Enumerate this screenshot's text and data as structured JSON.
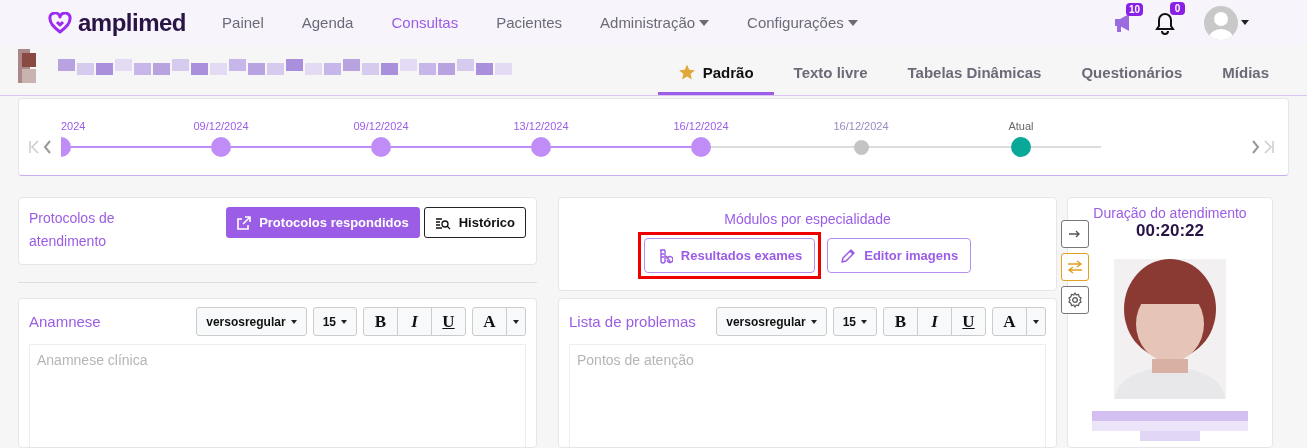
{
  "nav": {
    "logo": "amplimed",
    "items": [
      {
        "label": "Painel",
        "selected": false,
        "dropdown": false
      },
      {
        "label": "Agenda",
        "selected": false,
        "dropdown": false
      },
      {
        "label": "Consultas",
        "selected": true,
        "dropdown": false
      },
      {
        "label": "Pacientes",
        "selected": false,
        "dropdown": false
      },
      {
        "label": "Administração",
        "selected": false,
        "dropdown": true
      },
      {
        "label": "Configurações",
        "selected": false,
        "dropdown": true
      }
    ],
    "notifications": [
      {
        "kind": "megaphone",
        "count": "10"
      },
      {
        "kind": "bell",
        "count": "0"
      }
    ]
  },
  "record_tabs": [
    {
      "label": "Padrão",
      "selected": true,
      "starred": true
    },
    {
      "label": "Texto livre",
      "selected": false,
      "starred": false
    },
    {
      "label": "Tabelas Dinâmicas",
      "selected": false,
      "starred": false
    },
    {
      "label": "Questionários",
      "selected": false,
      "starred": false
    },
    {
      "label": "Mídias",
      "selected": false,
      "starred": false
    }
  ],
  "timeline": {
    "points": [
      {
        "date": "2024",
        "kind": "done"
      },
      {
        "date": "09/12/2024",
        "kind": "done"
      },
      {
        "date": "09/12/2024",
        "kind": "done"
      },
      {
        "date": "13/12/2024",
        "kind": "done"
      },
      {
        "date": "16/12/2024",
        "kind": "done"
      },
      {
        "date": "16/12/2024",
        "kind": "pending"
      },
      {
        "date": "Atual",
        "kind": "current"
      }
    ]
  },
  "protocols": {
    "title": "Protocolos de atendimento",
    "buttons": [
      {
        "label": "Protocolos respondidos",
        "kind": "primary"
      },
      {
        "label": "Histórico",
        "kind": "outline"
      }
    ]
  },
  "modules": {
    "title": "Módulos por especialidade",
    "buttons": [
      {
        "label": "Resultados exames",
        "highlighted": true
      },
      {
        "label": "Editor imagens",
        "highlighted": false
      }
    ]
  },
  "editors": [
    {
      "title": "Anamnese",
      "font": "versosregular",
      "size": "15",
      "format_buttons": [
        "B",
        "I",
        "U",
        "A"
      ],
      "placeholder": "Anamnese clínica"
    },
    {
      "title": "Lista de problemas",
      "font": "versosregular",
      "size": "15",
      "format_buttons": [
        "B",
        "I",
        "U",
        "A"
      ],
      "placeholder": "Pontos de atenção"
    }
  ],
  "side_tools": [
    {
      "kind": "arrow",
      "active": false
    },
    {
      "kind": "swap",
      "active": true
    },
    {
      "kind": "settings",
      "active": false
    }
  ],
  "session": {
    "title": "Duração do atendimento",
    "timer": "00:20:22"
  }
}
